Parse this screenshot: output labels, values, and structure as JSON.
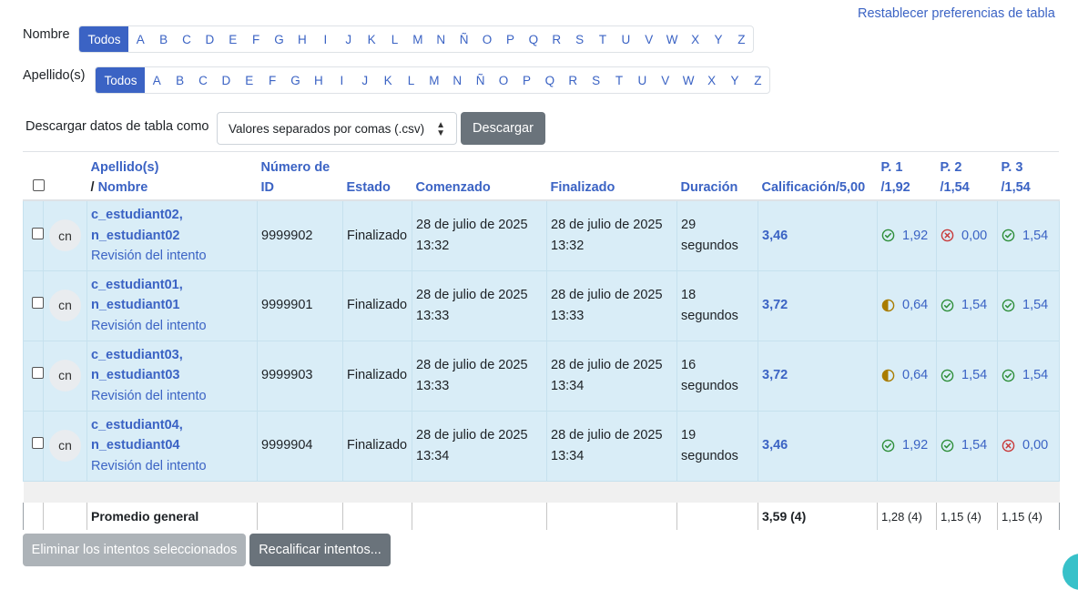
{
  "reset_link": "Restablecer preferencias de tabla",
  "filters": {
    "first_name": {
      "label": "Nombre",
      "all": "Todos",
      "letters": [
        "A",
        "B",
        "C",
        "D",
        "E",
        "F",
        "G",
        "H",
        "I",
        "J",
        "K",
        "L",
        "M",
        "N",
        "Ñ",
        "O",
        "P",
        "Q",
        "R",
        "S",
        "T",
        "U",
        "V",
        "W",
        "X",
        "Y",
        "Z"
      ]
    },
    "last_name": {
      "label": "Apellido(s)",
      "all": "Todos",
      "letters": [
        "A",
        "B",
        "C",
        "D",
        "E",
        "F",
        "G",
        "H",
        "I",
        "J",
        "K",
        "L",
        "M",
        "N",
        "Ñ",
        "O",
        "P",
        "Q",
        "R",
        "S",
        "T",
        "U",
        "V",
        "W",
        "X",
        "Y",
        "Z"
      ]
    }
  },
  "download": {
    "label": "Descargar datos de tabla como",
    "format": "Valores separados por comas (.csv)",
    "button": "Descargar"
  },
  "table": {
    "headers": {
      "name_1": "Apellido(s)",
      "name_sep": "/ ",
      "name_2": "Nombre",
      "id": "Número de ID",
      "state": "Estado",
      "started": "Comenzado",
      "finished": "Finalizado",
      "duration": "Duración",
      "grade": "Calificación/5,00",
      "q1a": "P. 1",
      "q1b": "/1,92",
      "q2a": "P. 2",
      "q2b": "/1,54",
      "q3a": "P. 3",
      "q3b": "/1,54"
    },
    "rows": [
      {
        "avatar": "cn",
        "name_1": "c_estudiant02,",
        "name_2": "n_estudiant02",
        "review": "Revisión del intento",
        "id": "9999902",
        "state": "Finalizado",
        "started_1": "28 de julio de 2025",
        "started_2": "13:32",
        "finished_1": "28 de julio de 2025",
        "finished_2": "13:32",
        "duration_1": "29",
        "duration_2": "segundos",
        "grade": "3,46",
        "q1": "1,92",
        "q1_status": "correct",
        "q2": "0,00",
        "q2_status": "incorrect",
        "q3": "1,54",
        "q3_status": "correct"
      },
      {
        "avatar": "cn",
        "name_1": "c_estudiant01,",
        "name_2": "n_estudiant01",
        "review": "Revisión del intento",
        "id": "9999901",
        "state": "Finalizado",
        "started_1": "28 de julio de 2025",
        "started_2": "13:33",
        "finished_1": "28 de julio de 2025",
        "finished_2": "13:33",
        "duration_1": "18",
        "duration_2": "segundos",
        "grade": "3,72",
        "q1": "0,64",
        "q1_status": "partial",
        "q2": "1,54",
        "q2_status": "correct",
        "q3": "1,54",
        "q3_status": "correct"
      },
      {
        "avatar": "cn",
        "name_1": "c_estudiant03,",
        "name_2": "n_estudiant03",
        "review": "Revisión del intento",
        "id": "9999903",
        "state": "Finalizado",
        "started_1": "28 de julio de 2025",
        "started_2": "13:33",
        "finished_1": "28 de julio de 2025",
        "finished_2": "13:34",
        "duration_1": "16",
        "duration_2": "segundos",
        "grade": "3,72",
        "q1": "0,64",
        "q1_status": "partial",
        "q2": "1,54",
        "q2_status": "correct",
        "q3": "1,54",
        "q3_status": "correct"
      },
      {
        "avatar": "cn",
        "name_1": "c_estudiant04,",
        "name_2": "n_estudiant04",
        "review": "Revisión del intento",
        "id": "9999904",
        "state": "Finalizado",
        "started_1": "28 de julio de 2025",
        "started_2": "13:34",
        "finished_1": "28 de julio de 2025",
        "finished_2": "13:34",
        "duration_1": "19",
        "duration_2": "segundos",
        "grade": "3,46",
        "q1": "1,92",
        "q1_status": "correct",
        "q2": "1,54",
        "q2_status": "correct",
        "q3": "0,00",
        "q3_status": "incorrect"
      }
    ],
    "average": {
      "label": "Promedio general",
      "grade": "3,59 (4)",
      "q1": "1,28 (4)",
      "q2": "1,15 (4)",
      "q3": "1,15 (4)"
    }
  },
  "actions": {
    "delete": "Eliminar los intentos seleccionados",
    "regrade": "Recalificar intentos..."
  },
  "colors": {
    "accent": "#3b63c4",
    "row_highlight": "#d9edf7",
    "correct": "#2f8f3a",
    "incorrect": "#c83a3a",
    "partial": "#a97c00"
  },
  "icons": {
    "correct": "check-circle-icon",
    "incorrect": "x-circle-icon",
    "partial": "half-circle-icon"
  }
}
